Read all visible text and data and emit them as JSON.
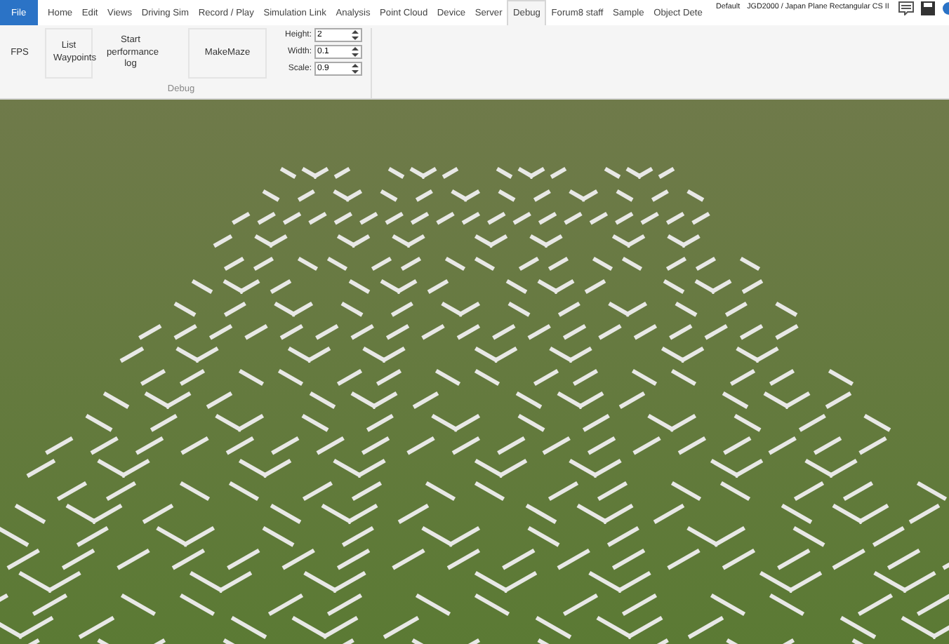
{
  "tabs": [
    {
      "label": "File",
      "kind": "app",
      "selected": false
    },
    {
      "label": "Home",
      "kind": "tab",
      "selected": false
    },
    {
      "label": "Edit",
      "kind": "tab",
      "selected": false
    },
    {
      "label": "Views",
      "kind": "tab",
      "selected": false
    },
    {
      "label": "Driving Sim",
      "kind": "tab",
      "selected": false
    },
    {
      "label": "Record / Play",
      "kind": "tab",
      "selected": false
    },
    {
      "label": "Simulation Link",
      "kind": "tab",
      "selected": false
    },
    {
      "label": "Analysis",
      "kind": "tab",
      "selected": false
    },
    {
      "label": "Point Cloud",
      "kind": "tab",
      "selected": false
    },
    {
      "label": "Device",
      "kind": "tab",
      "selected": false
    },
    {
      "label": "Server",
      "kind": "tab",
      "selected": false
    },
    {
      "label": "Debug",
      "kind": "tab",
      "selected": true
    },
    {
      "label": "Forum8 staff",
      "kind": "tab",
      "selected": false
    },
    {
      "label": "Sample",
      "kind": "tab",
      "selected": false
    },
    {
      "label": "Object Dete",
      "kind": "tab",
      "selected": false
    }
  ],
  "status": {
    "profile": "Default",
    "coordinate_system": "JGD2000 / Japan Plane Rectangular CS II"
  },
  "ribbon": {
    "group_label": "Debug",
    "buttons": [
      "FPS",
      "List Waypoints",
      "Start performance log",
      "MakeMaze"
    ],
    "fields": [
      {
        "label": "Height:",
        "value": "2"
      },
      {
        "label": "Width:",
        "value": "0.1"
      },
      {
        "label": "Scale:",
        "value": "0.9"
      }
    ]
  }
}
